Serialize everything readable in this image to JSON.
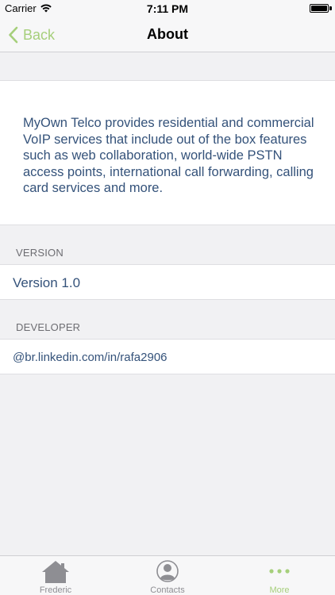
{
  "status_bar": {
    "carrier": "Carrier",
    "time": "7:11 PM",
    "wifi_icon": "wifi-icon",
    "battery_icon": "battery-icon"
  },
  "nav": {
    "back_label": "Back",
    "title": "About",
    "accent_color": "#a6cf7b"
  },
  "about": {
    "description": "MyOwn Telco provides residential and commercial VoIP services that include out of the box features such as web collaboration, world-wide PSTN access points, international call forwarding, calling card services and more."
  },
  "sections": {
    "version_header": "VERSION",
    "version_value": "Version 1.0",
    "developer_header": "DEVELOPER",
    "developer_value": "@br.linkedin.com/in/rafa2906"
  },
  "tab_bar": {
    "tabs": [
      {
        "label": "Frederic",
        "icon": "home-icon",
        "active": false
      },
      {
        "label": "Contacts",
        "icon": "contacts-icon",
        "active": false
      },
      {
        "label": "More",
        "icon": "more-icon",
        "active": true
      }
    ]
  }
}
